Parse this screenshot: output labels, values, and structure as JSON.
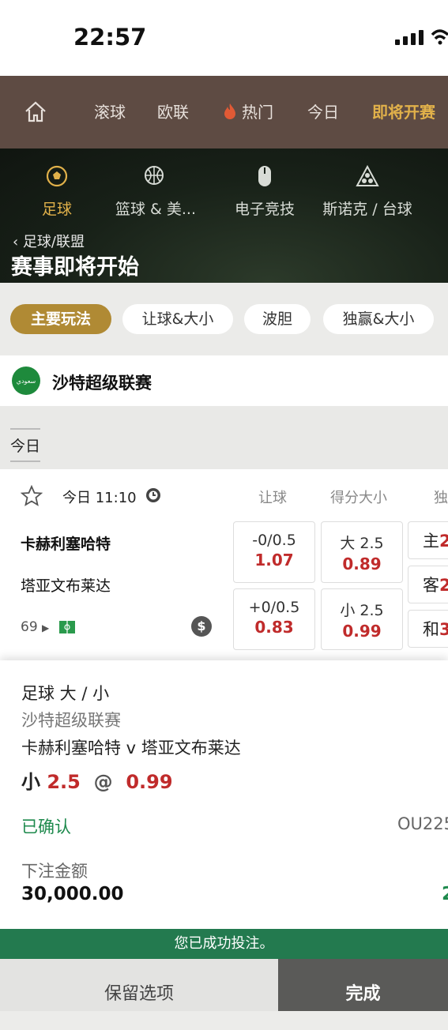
{
  "status": {
    "time": "22:57"
  },
  "topnav": {
    "items": [
      "滚球",
      "欧联",
      "热门",
      "今日",
      "即将开赛"
    ]
  },
  "sports": {
    "items": [
      "足球",
      "篮球 & 美...",
      "电子竞技",
      "斯诺克 / 台球"
    ],
    "breadcrumb": "足球/联盟",
    "title": "赛事即将开始"
  },
  "pills": [
    "主要玩法",
    "让球&大小",
    "波胆",
    "独赢&大小"
  ],
  "league": {
    "name": "沙特超级联赛",
    "flag_text": "سعودي"
  },
  "day_tab": "今日",
  "match": {
    "time": "今日 11:10",
    "col_headers": [
      "让球",
      "得分大小",
      "独"
    ],
    "home": "卡赫利塞哈特",
    "away": "塔亚文布莱达",
    "more_count": "69",
    "coin": "$",
    "handicap": [
      {
        "line": "-0/0.5",
        "odds": "1.07"
      },
      {
        "line": "+0/0.5",
        "odds": "0.83"
      }
    ],
    "total": [
      {
        "line": "大 2.5",
        "odds": "0.89"
      },
      {
        "line": "小 2.5",
        "odds": "0.99"
      }
    ],
    "moneyline": [
      {
        "label": "主",
        "odds": "2"
      },
      {
        "label": "客",
        "odds": "2"
      },
      {
        "label": "和",
        "odds": "3"
      }
    ]
  },
  "slip": {
    "market": "足球 大 / 小",
    "league": "沙特超级联赛",
    "fixture": "卡赫利塞哈特 v 塔亚文布莱达",
    "sel_label": "小",
    "sel_line": "2.5",
    "sel_at": "@",
    "sel_odds": "0.99",
    "status": "已确认",
    "ref": "OU225",
    "amount_label": "下注金额",
    "amount": "30,000.00",
    "amount_right": "2"
  },
  "banner": "您已成功投注。",
  "buttons": {
    "keep": "保留选项",
    "done": "完成"
  },
  "colors": {
    "brand_bar": "#5e4b43",
    "gold": "#b08a34",
    "odds_red": "#c02b2b",
    "success_green": "#237a4f"
  }
}
